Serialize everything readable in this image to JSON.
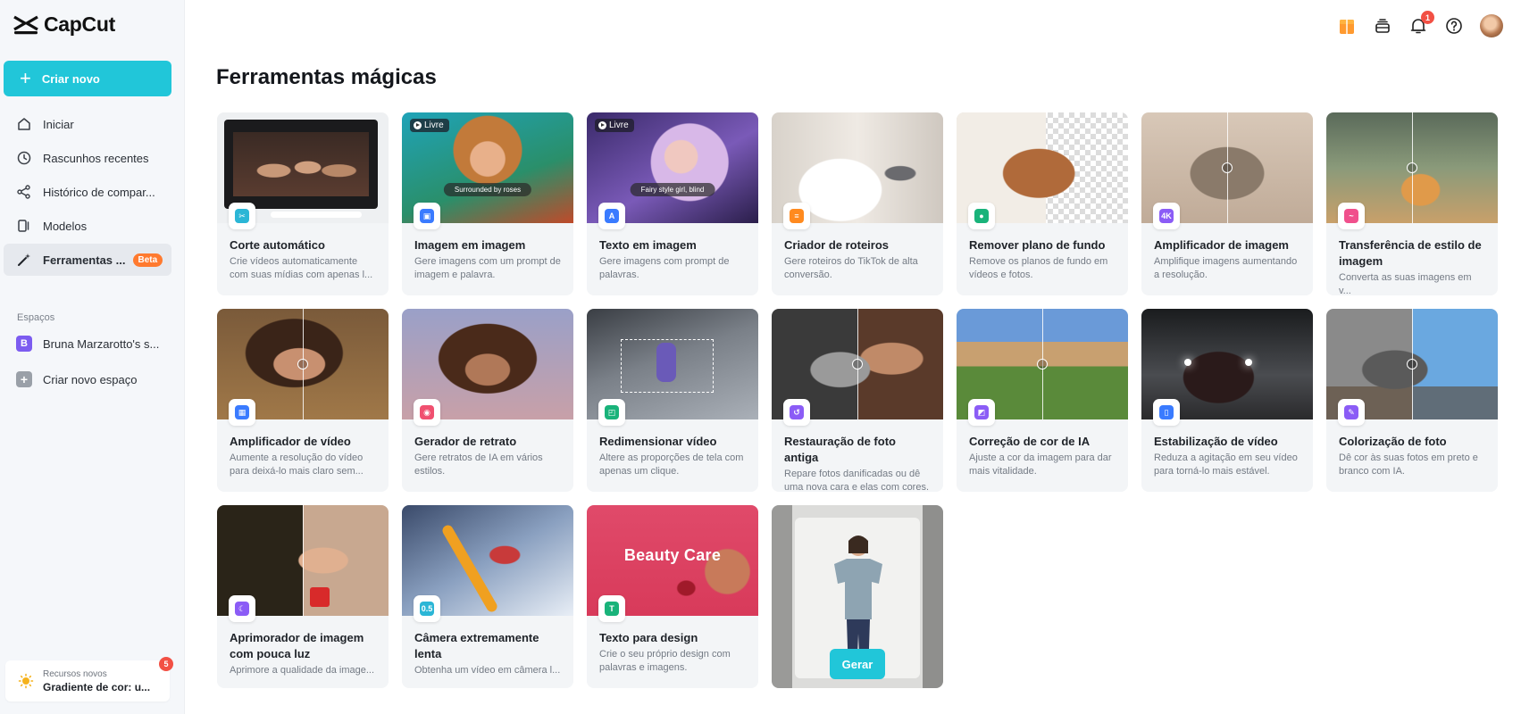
{
  "app": {
    "name": "CapCut"
  },
  "sidebar": {
    "create_label": "Criar novo",
    "items": [
      {
        "label": "Iniciar",
        "icon": "home-icon",
        "active": false
      },
      {
        "label": "Rascunhos recentes",
        "icon": "clock-icon",
        "active": false
      },
      {
        "label": "Histórico de compar...",
        "icon": "share-icon",
        "active": false
      },
      {
        "label": "Modelos",
        "icon": "templates-icon",
        "active": false
      },
      {
        "label": "Ferramentas ...",
        "icon": "magic-wand-icon",
        "active": true,
        "badge": "Beta"
      }
    ],
    "spaces_title": "Espaços",
    "space_name": "Bruna Marzarotto's s...",
    "space_initial": "B",
    "create_space_label": "Criar novo espaço",
    "news": {
      "small": "Recursos novos",
      "title": "Gradiente de cor: u...",
      "badge": "5"
    }
  },
  "header": {
    "icons": [
      "gift-icon",
      "stack-icon",
      "bell-icon",
      "help-icon"
    ],
    "notifications_count": "1"
  },
  "main": {
    "title": "Ferramentas mágicas",
    "tools": [
      {
        "title": "Corte automático",
        "desc": "Crie vídeos automaticamente com suas mídias com apenas l...",
        "icon": "auto-cut-icon",
        "accent": "#2bb6d6"
      },
      {
        "title": "Imagem em imagem",
        "desc": "Gere imagens com um prompt de imagem e palavra.",
        "icon": "image-to-image-icon",
        "accent": "#3a7bff",
        "tag": "Livre",
        "caption": "Surrounded by roses"
      },
      {
        "title": "Texto em imagem",
        "desc": "Gere imagens com prompt de palavras.",
        "icon": "text-to-image-icon",
        "accent": "#3a7bff",
        "tag": "Livre",
        "caption": "Fairy style girl, blind"
      },
      {
        "title": "Criador de roteiros",
        "desc": "Gere roteiros do TikTok de alta conversão.",
        "icon": "script-icon",
        "accent": "#ff8a1f"
      },
      {
        "title": "Remover plano de fundo",
        "desc": "Remove os planos de fundo em vídeos e fotos.",
        "icon": "remove-background-icon",
        "accent": "#19b37a"
      },
      {
        "title": "Amplificador de imagem",
        "desc": "Amplifique imagens aumentando a resolução.",
        "icon": "image-upscaler-icon",
        "accent": "#8b5cf6"
      },
      {
        "title": "Transferência de estilo de imagem",
        "desc": "Converta as suas imagens em v...",
        "icon": "style-transfer-icon",
        "accent": "#f0508c"
      },
      {
        "title": "Amplificador de vídeo",
        "desc": "Aumente a resolução do vídeo para deixá-lo mais claro sem...",
        "icon": "video-upscaler-icon",
        "accent": "#3a7bff"
      },
      {
        "title": "Gerador de retrato",
        "desc": "Gere retratos de IA em vários estilos.",
        "icon": "portrait-icon",
        "accent": "#f05070"
      },
      {
        "title": "Redimensionar vídeo",
        "desc": "Altere as proporções de tela com apenas um clique.",
        "icon": "resize-icon",
        "accent": "#19b37a"
      },
      {
        "title": "Restauração de foto antiga",
        "desc": "Repare fotos danificadas ou dê uma nova cara e elas com cores.",
        "icon": "photo-restore-icon",
        "accent": "#8b5cf6"
      },
      {
        "title": "Correção de cor de IA",
        "desc": "Ajuste a cor da imagem para dar mais vitalidade.",
        "icon": "color-correction-icon",
        "accent": "#8b5cf6"
      },
      {
        "title": "Estabilização de vídeo",
        "desc": "Reduza a agitação em seu vídeo para torná-lo mais estável.",
        "icon": "stabilize-icon",
        "accent": "#3a7bff"
      },
      {
        "title": "Colorização de foto",
        "desc": "Dê cor às suas fotos em preto e branco com IA.",
        "icon": "colorize-icon",
        "accent": "#8b5cf6"
      },
      {
        "title": "Aprimorador de imagem com pouca luz",
        "desc": "Aprimore a qualidade da image...",
        "icon": "low-light-icon",
        "accent": "#8b5cf6"
      },
      {
        "title": "Câmera extremamente lenta",
        "desc": "Obtenha um vídeo em câmera l...",
        "icon": "slow-motion-icon",
        "accent": "#2bb6d6"
      },
      {
        "title": "Texto para design",
        "desc": "Crie o seu próprio design com palavras e imagens.",
        "icon": "text-to-design-icon",
        "accent": "#19b37a",
        "overlay": "Beauty Care"
      }
    ],
    "promo": {
      "button_label": "Gerar"
    }
  }
}
